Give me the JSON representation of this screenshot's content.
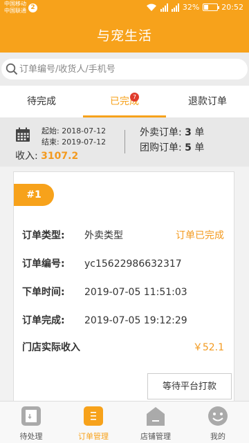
{
  "status_bar": {
    "carrier_1": "中国移动",
    "carrier_2": "中国联通",
    "sim_badge": "2",
    "battery": "32%",
    "time": "20:52"
  },
  "header": {
    "title": "与宠生活"
  },
  "search": {
    "placeholder": "订单编号/收货人/手机号"
  },
  "tabs": [
    {
      "label": "待完成"
    },
    {
      "label": "已完成",
      "badge": "7",
      "active": true
    },
    {
      "label": "退款订单"
    }
  ],
  "summary": {
    "start_label": "起始:",
    "start_date": "2018-07-12",
    "end_label": "结束:",
    "end_date": "2019-07-12",
    "income_label": "收入:",
    "income_value": "3107.2",
    "takeout_label": "外卖订单:",
    "takeout_count": "3",
    "group_label": "团购订单:",
    "group_count": "5",
    "unit": "单"
  },
  "order": {
    "index": "#1",
    "type_label": "订单类型:",
    "type_value": "外卖类型",
    "status": "订单已完成",
    "no_label": "订单编号:",
    "no_value": "yc15622986632317",
    "placed_label": "下单时间:",
    "placed_value": "2019-07-05 11:51:03",
    "done_label": "订单完成:",
    "done_value": "2019-07-05 19:12:29",
    "income_label": "门店实际收入",
    "income_value": "￥52.1",
    "action": "等待平台打款"
  },
  "bottom_nav": [
    {
      "label": "待处理",
      "icon": "pending-orders-icon"
    },
    {
      "label": "订单管理",
      "icon": "order-list-icon",
      "active": true
    },
    {
      "label": "店铺管理",
      "icon": "store-icon"
    },
    {
      "label": "我的",
      "icon": "profile-face-icon"
    }
  ],
  "colors": {
    "accent": "#f7a21b",
    "badge": "#e03b2c"
  }
}
